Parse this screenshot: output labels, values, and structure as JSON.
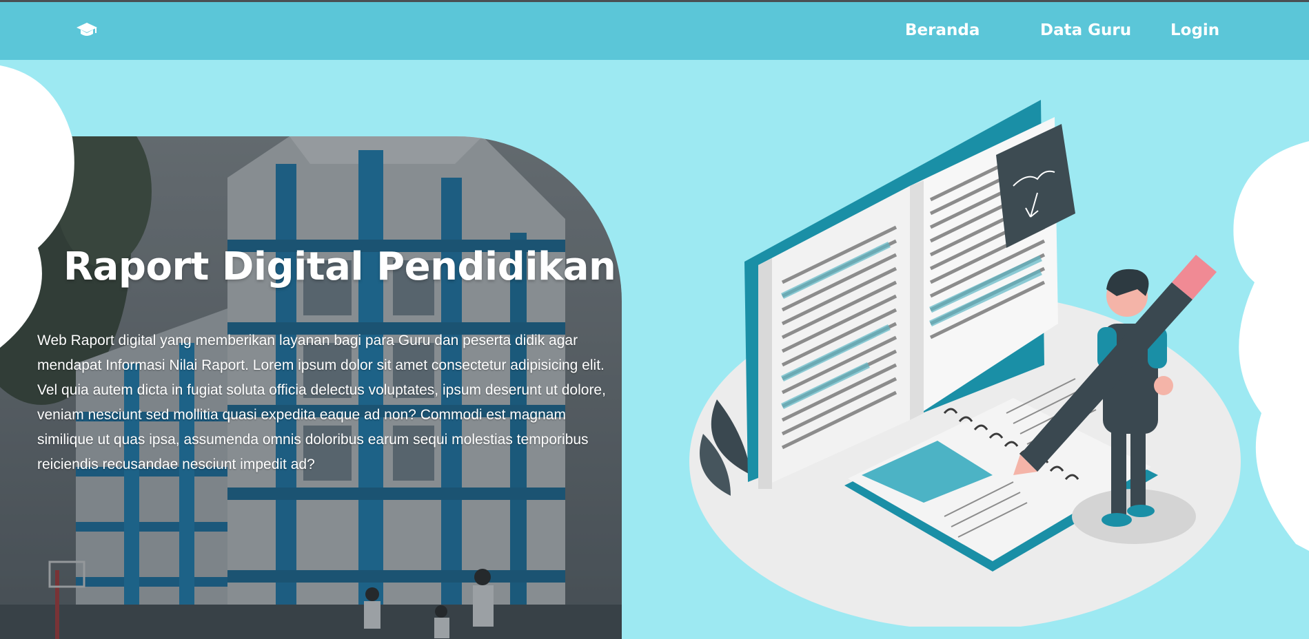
{
  "nav": {
    "logo_icon": "graduation-cap-icon",
    "links": [
      "Beranda",
      "Data Guru",
      "Login"
    ]
  },
  "hero": {
    "title": "Raport Digital Pendidikan",
    "description": "Web Raport digital yang memberikan layanan bagi para Guru dan peserta didik agar mendapat Informasi Nilai Raport. Lorem ipsum dolor sit amet consectetur adipisicing elit. Vel quia autem dicta in fugiat soluta officia delectus voluptates, ipsum deserunt ut dolore, veniam nesciunt sed mollitia quasi expedita eaque ad non? Commodi est magnam similique ut quas ipsa, assumenda omnis doloribus earum sequi molestias temporibus reiciendis recusandae nesciunt impedit ad?",
    "photo": "school-building-photo",
    "illustration": "book-and-student-illustration"
  },
  "colors": {
    "navbar": "#5bc6d8",
    "background": "#9de9f2",
    "accent": "#1a8fa6",
    "text": "#ffffff"
  }
}
